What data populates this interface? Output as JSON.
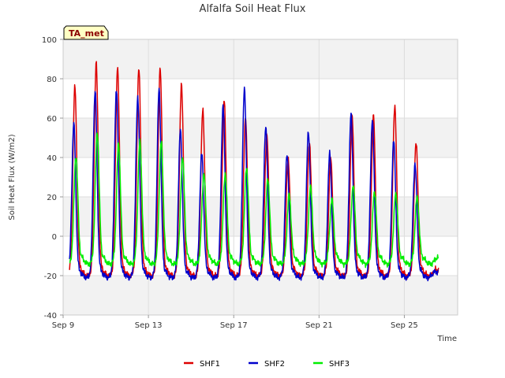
{
  "chart_data": {
    "type": "line",
    "title": "Alfalfa Soil Heat Flux",
    "xlabel": "Time",
    "ylabel": "Soil Heat Flux (W/m2)",
    "badge": "TA_met",
    "ylim": [
      -40,
      100
    ],
    "y_ticks": [
      -40,
      -20,
      0,
      20,
      40,
      60,
      80,
      100
    ],
    "x_range_days": [
      9,
      27.5
    ],
    "x_ticks": [
      {
        "day": 9,
        "label": "Sep 9"
      },
      {
        "day": 13,
        "label": "Sep 13"
      },
      {
        "day": 17,
        "label": "Sep 17"
      },
      {
        "day": 21,
        "label": "Sep 21"
      },
      {
        "day": 25,
        "label": "Sep 25"
      }
    ],
    "series_start_day": 9.3,
    "series_end_day": 26.6,
    "legend_position": "bottom-center",
    "grid": true,
    "series": [
      {
        "name": "SHF1",
        "color": "#dd0000",
        "night": -17,
        "peaks": [
          {
            "day": 9.55,
            "value": 76
          },
          {
            "day": 10.55,
            "value": 88
          },
          {
            "day": 11.55,
            "value": 86
          },
          {
            "day": 12.55,
            "value": 86
          },
          {
            "day": 13.55,
            "value": 86
          },
          {
            "day": 14.55,
            "value": 77
          },
          {
            "day": 15.55,
            "value": 64
          },
          {
            "day": 16.55,
            "value": 69
          },
          {
            "day": 17.55,
            "value": 60
          },
          {
            "day": 18.55,
            "value": 52
          },
          {
            "day": 19.55,
            "value": 40
          },
          {
            "day": 20.55,
            "value": 48
          },
          {
            "day": 21.55,
            "value": 40
          },
          {
            "day": 22.55,
            "value": 61
          },
          {
            "day": 23.55,
            "value": 61
          },
          {
            "day": 24.55,
            "value": 66
          },
          {
            "day": 25.55,
            "value": 48
          }
        ]
      },
      {
        "name": "SHF2",
        "color": "#0000cc",
        "night": -18,
        "peaks": [
          {
            "day": 9.5,
            "value": 57
          },
          {
            "day": 10.5,
            "value": 74
          },
          {
            "day": 11.5,
            "value": 75
          },
          {
            "day": 12.5,
            "value": 71
          },
          {
            "day": 13.5,
            "value": 75
          },
          {
            "day": 14.5,
            "value": 54
          },
          {
            "day": 15.5,
            "value": 42
          },
          {
            "day": 16.5,
            "value": 66
          },
          {
            "day": 17.5,
            "value": 75
          },
          {
            "day": 18.5,
            "value": 56
          },
          {
            "day": 19.5,
            "value": 42
          },
          {
            "day": 20.5,
            "value": 53
          },
          {
            "day": 21.5,
            "value": 42
          },
          {
            "day": 22.5,
            "value": 62
          },
          {
            "day": 23.5,
            "value": 59
          },
          {
            "day": 24.5,
            "value": 49
          },
          {
            "day": 25.5,
            "value": 37
          }
        ]
      },
      {
        "name": "SHF3",
        "color": "#00ee00",
        "night": -11,
        "peaks": [
          {
            "day": 9.6,
            "value": 41
          },
          {
            "day": 10.6,
            "value": 53
          },
          {
            "day": 11.6,
            "value": 47
          },
          {
            "day": 12.6,
            "value": 48
          },
          {
            "day": 13.6,
            "value": 48
          },
          {
            "day": 14.6,
            "value": 40
          },
          {
            "day": 15.6,
            "value": 32
          },
          {
            "day": 16.6,
            "value": 32
          },
          {
            "day": 17.6,
            "value": 35
          },
          {
            "day": 18.6,
            "value": 29
          },
          {
            "day": 19.6,
            "value": 21
          },
          {
            "day": 20.6,
            "value": 25
          },
          {
            "day": 21.6,
            "value": 19
          },
          {
            "day": 22.6,
            "value": 26
          },
          {
            "day": 23.6,
            "value": 23
          },
          {
            "day": 24.6,
            "value": 22
          },
          {
            "day": 25.6,
            "value": 20
          }
        ]
      }
    ]
  }
}
